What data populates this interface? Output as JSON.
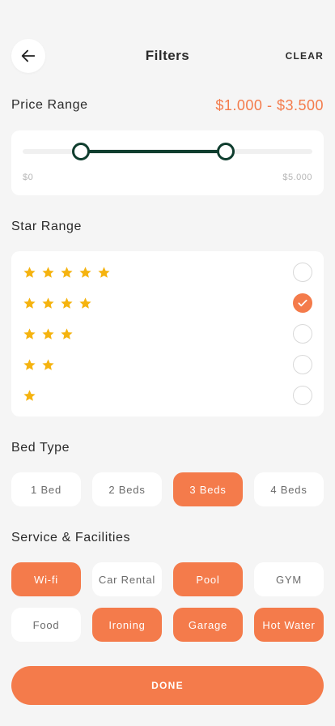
{
  "header": {
    "title": "Filters",
    "clear_label": "CLEAR",
    "back_icon": "arrow-left-icon"
  },
  "price": {
    "section_title": "Price Range",
    "selected_range": "$1.000 - $3.500",
    "min_label": "$0",
    "max_label": "$5.000",
    "min": 0,
    "max": 5000,
    "low": 1000,
    "high": 3500
  },
  "stars": {
    "section_title": "Star Range",
    "options": [
      {
        "count": 5,
        "checked": false
      },
      {
        "count": 4,
        "checked": true
      },
      {
        "count": 3,
        "checked": false
      },
      {
        "count": 2,
        "checked": false
      },
      {
        "count": 1,
        "checked": false
      }
    ]
  },
  "bed": {
    "section_title": "Bed Type",
    "options": [
      {
        "label": "1 Bed",
        "active": false
      },
      {
        "label": "2 Beds",
        "active": false
      },
      {
        "label": "3 Beds",
        "active": true
      },
      {
        "label": "4 Beds",
        "active": false
      }
    ]
  },
  "facilities": {
    "section_title": "Service & Facilities",
    "options": [
      {
        "label": "Wi-fi",
        "active": true
      },
      {
        "label": "Car Rental",
        "active": false
      },
      {
        "label": "Pool",
        "active": true
      },
      {
        "label": "GYM",
        "active": false
      },
      {
        "label": "Food",
        "active": false
      },
      {
        "label": "Ironing",
        "active": true
      },
      {
        "label": "Garage",
        "active": true
      },
      {
        "label": "Hot Water",
        "active": true
      }
    ]
  },
  "done_label": "DONE",
  "colors": {
    "accent": "#f47b4b",
    "slider": "#0f3d2e",
    "star": "#f5b30f"
  }
}
